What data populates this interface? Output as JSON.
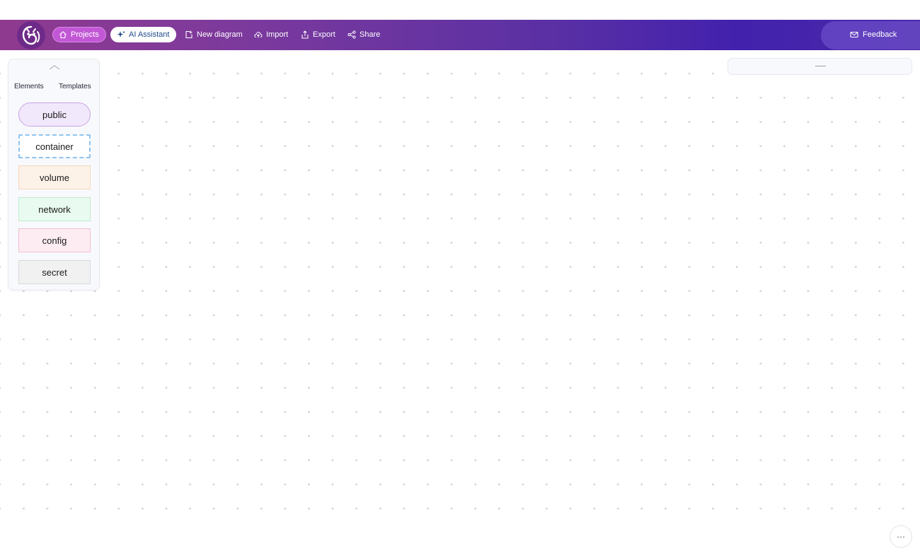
{
  "topbar": {
    "logo_icon": "owl-logo-icon",
    "projects_label": "Projects",
    "ai_assistant_label": "AI Assistant",
    "new_diagram_label": "New diagram",
    "import_label": "Import",
    "export_label": "Export",
    "share_label": "Share",
    "feedback_label": "Feedback",
    "colors": {
      "gradient_start": "#8e3a8e",
      "gradient_end": "#4221ad",
      "projects_active": "#c257d6"
    }
  },
  "sidebar": {
    "tabs": [
      {
        "label": "Elements",
        "active": true
      },
      {
        "label": "Templates",
        "active": false
      }
    ],
    "elements": [
      {
        "label": "public",
        "color": "#f2e8fb"
      },
      {
        "label": "container",
        "color": "#ffffff"
      },
      {
        "label": "volume",
        "color": "#fdf2e8"
      },
      {
        "label": "network",
        "color": "#e9fbf0"
      },
      {
        "label": "config",
        "color": "#fdedf2"
      },
      {
        "label": "secret",
        "color": "#f1f1f2"
      }
    ]
  },
  "canvas": {
    "more_label": "···"
  }
}
